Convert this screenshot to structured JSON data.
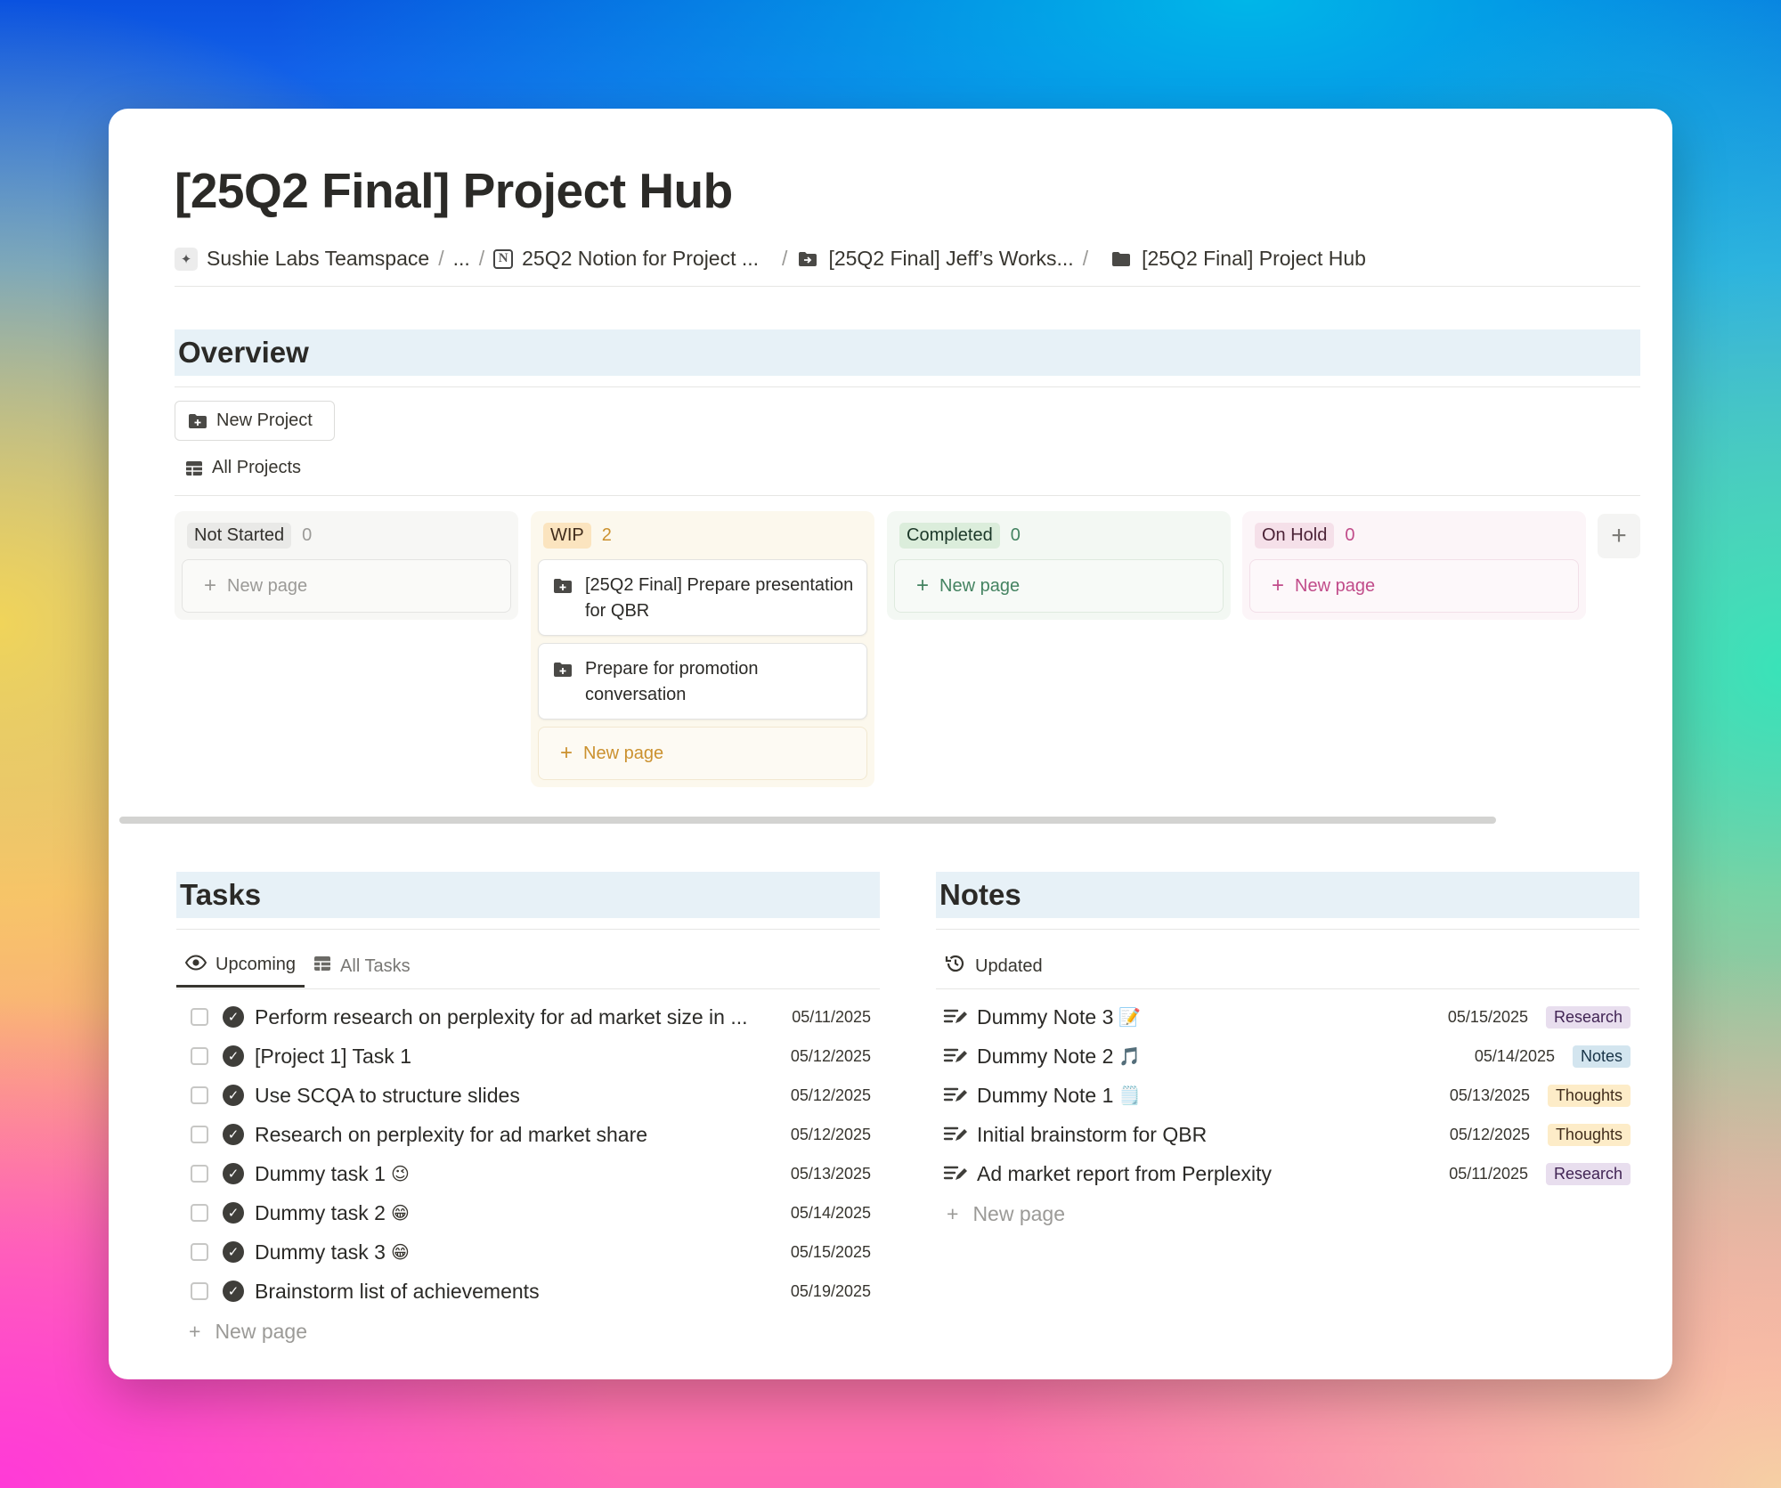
{
  "page": {
    "title": "[25Q2 Final] Project Hub"
  },
  "breadcrumb": [
    {
      "label": "Sushie Labs Teamspace",
      "icon": "sparkle-icon"
    },
    {
      "label": "...",
      "icon": ""
    },
    {
      "label": "25Q2 Notion for Project ...",
      "icon": "notion-icon"
    },
    {
      "label": "[25Q2 Final] Jeff’s Works...",
      "icon": "folder-arrow-icon"
    },
    {
      "label": "[25Q2 Final] Project Hub",
      "icon": "folder-icon"
    }
  ],
  "overview": {
    "heading": "Overview",
    "new_project_label": "New Project",
    "view_tab_label": "All Projects",
    "add_group_symbol": "+",
    "columns": [
      {
        "status": "Not Started",
        "count": "0",
        "new_page": "New page",
        "cards": [],
        "colors": {
          "bg": "#f7f7f5",
          "pill": "#e9e9e7",
          "pill_text": "#32302c",
          "count": "#9b9a97",
          "add_text": "#9b9a97",
          "add_border": "#e4e4e2"
        }
      },
      {
        "status": "WIP",
        "count": "2",
        "new_page": "New page",
        "cards": [
          "[25Q2 Final] Prepare presentation for QBR",
          "Prepare for promotion conversation"
        ],
        "colors": {
          "bg": "#fcf8ed",
          "pill": "#fbe4bf",
          "pill_text": "#402c1b",
          "count": "#cb912f",
          "add_text": "#cb912f",
          "add_border": "#f2e8d0"
        }
      },
      {
        "status": "Completed",
        "count": "0",
        "new_page": "New page",
        "cards": [],
        "colors": {
          "bg": "#f3f8f3",
          "pill": "#dbeddb",
          "pill_text": "#1c3829",
          "count": "#448361",
          "add_text": "#448361",
          "add_border": "#dfeadf"
        }
      },
      {
        "status": "On Hold",
        "count": "0",
        "new_page": "New page",
        "cards": [],
        "colors": {
          "bg": "#fcf5f8",
          "pill": "#f5e0e9",
          "pill_text": "#4c2337",
          "count": "#c14c8a",
          "add_text": "#c14c8a",
          "add_border": "#f2dfe8"
        }
      }
    ]
  },
  "tasks": {
    "heading": "Tasks",
    "tabs": [
      {
        "label": "Upcoming",
        "icon": "eye-icon",
        "active": true
      },
      {
        "label": "All Tasks",
        "icon": "table-icon",
        "active": false
      }
    ],
    "rows": [
      {
        "title": "Perform research on perplexity for ad market size in ...",
        "date": "05/11/2025",
        "emoji": ""
      },
      {
        "title": "[Project 1] Task 1",
        "date": "05/12/2025",
        "emoji": ""
      },
      {
        "title": "Use SCQA to structure slides",
        "date": "05/12/2025",
        "emoji": ""
      },
      {
        "title": "Research on perplexity for ad market share",
        "date": "05/12/2025",
        "emoji": ""
      },
      {
        "title": "Dummy task 1",
        "date": "05/13/2025",
        "emoji": "😉"
      },
      {
        "title": "Dummy task 2",
        "date": "05/14/2025",
        "emoji": "😁"
      },
      {
        "title": "Dummy task 3",
        "date": "05/15/2025",
        "emoji": "😁"
      },
      {
        "title": "Brainstorm list of achievements",
        "date": "05/19/2025",
        "emoji": ""
      }
    ],
    "new_page": "New page"
  },
  "notes": {
    "heading": "Notes",
    "tabs": [
      {
        "label": "Updated",
        "icon": "history-icon",
        "active": true
      }
    ],
    "rows": [
      {
        "title": "Dummy Note 3",
        "emoji": "📝",
        "date": "05/15/2025",
        "tag": "Research",
        "tag_bg": "#e8deee",
        "tag_color": "#412454"
      },
      {
        "title": "Dummy Note 2",
        "emoji": "🎵",
        "date": "05/14/2025",
        "tag": "Notes",
        "tag_bg": "#d3e5ef",
        "tag_color": "#183347"
      },
      {
        "title": "Dummy Note 1",
        "emoji": "🗒️",
        "date": "05/13/2025",
        "tag": "Thoughts",
        "tag_bg": "#fdecc8",
        "tag_color": "#402c1b"
      },
      {
        "title": "Initial brainstorm for QBR",
        "emoji": "",
        "date": "05/12/2025",
        "tag": "Thoughts",
        "tag_bg": "#fdecc8",
        "tag_color": "#402c1b"
      },
      {
        "title": "Ad market report from Perplexity",
        "emoji": "",
        "date": "05/11/2025",
        "tag": "Research",
        "tag_bg": "#e8deee",
        "tag_color": "#412454"
      }
    ],
    "new_page": "New page"
  }
}
